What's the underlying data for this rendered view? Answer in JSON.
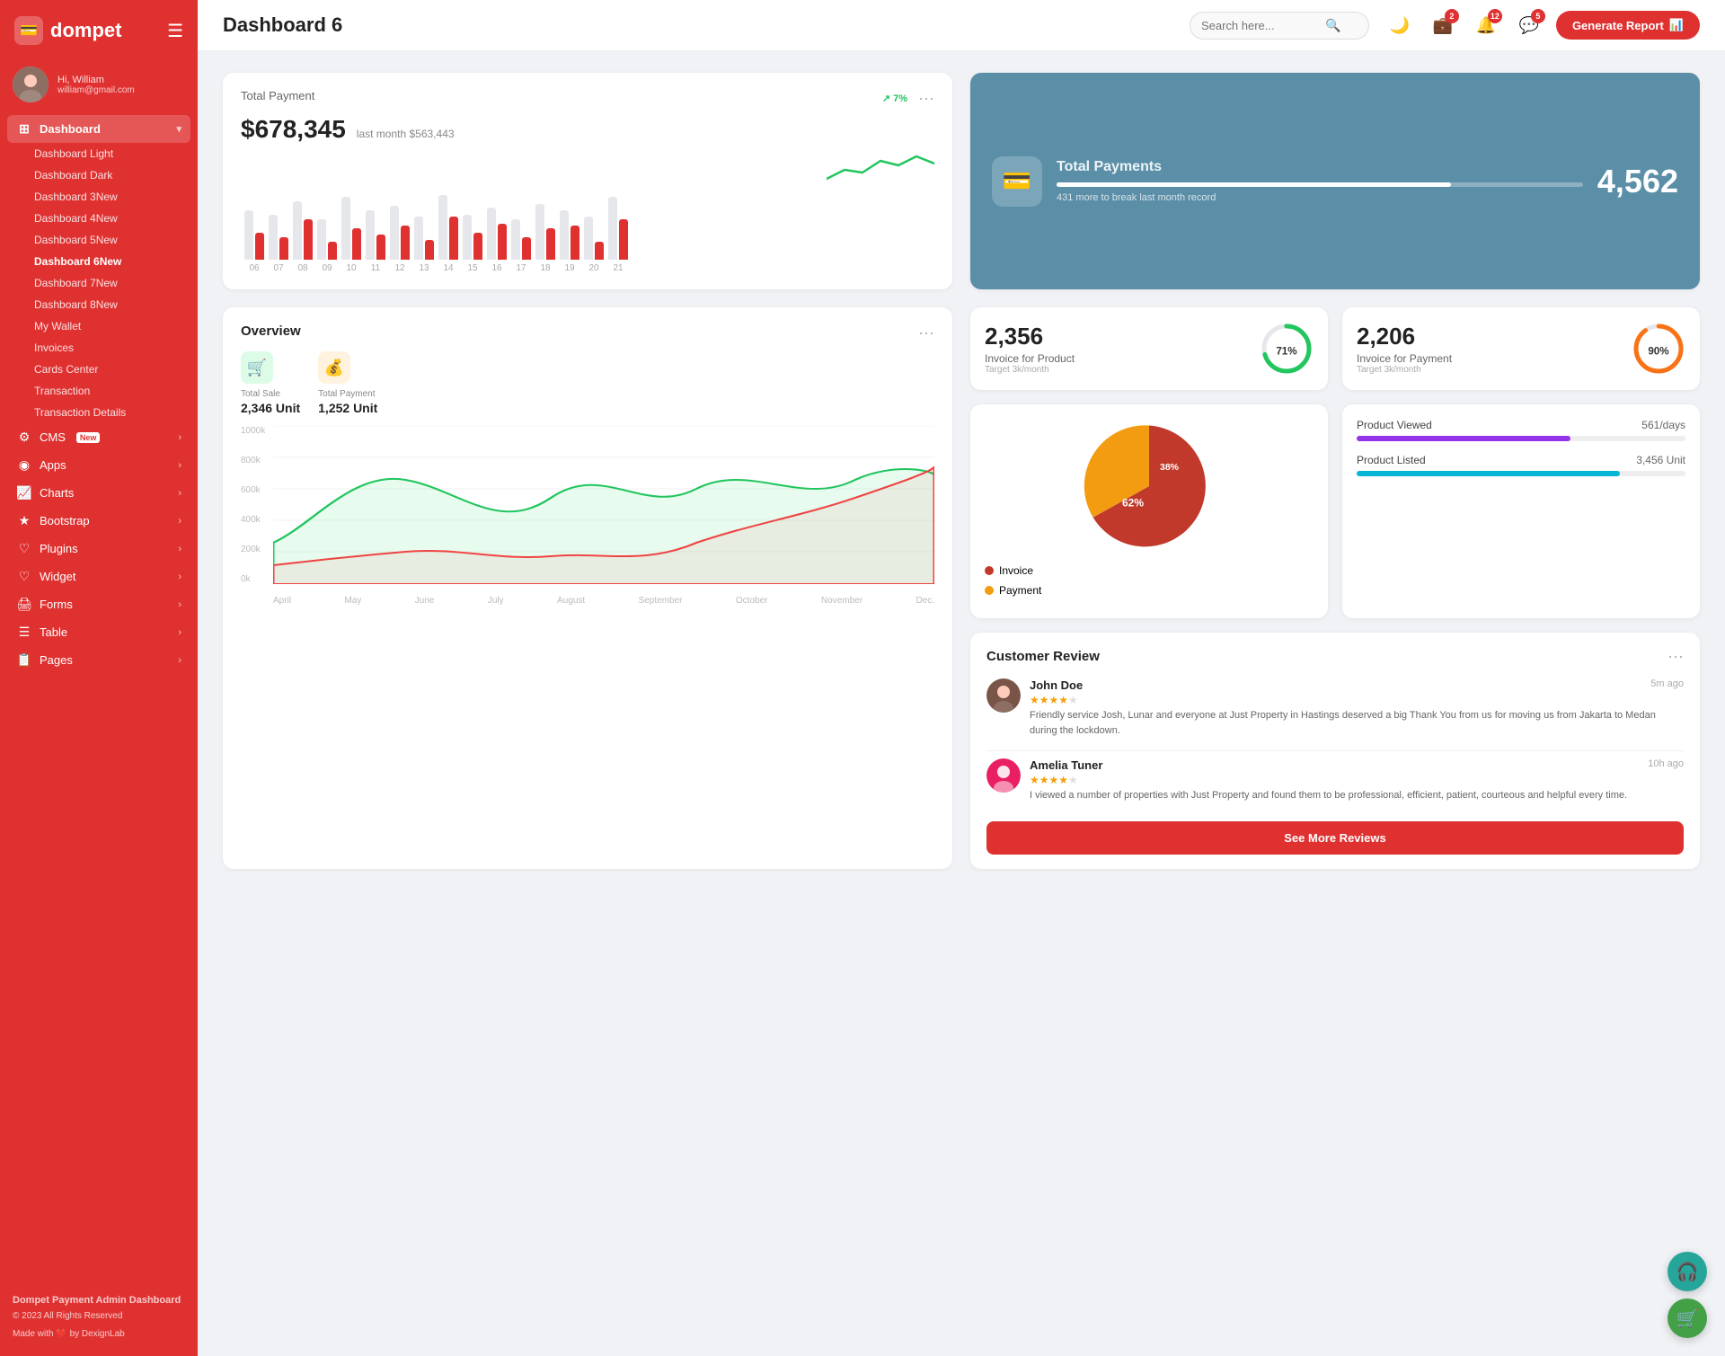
{
  "app": {
    "logo": "dompet",
    "logo_icon": "💳"
  },
  "user": {
    "greeting": "Hi, William",
    "name": "William",
    "email": "william@gmail.com"
  },
  "topbar": {
    "title": "Dashboard 6",
    "search_placeholder": "Search here...",
    "generate_btn": "Generate Report",
    "badges": {
      "wallet": "2",
      "bell": "12",
      "chat": "5"
    }
  },
  "sidebar": {
    "dashboard_label": "Dashboard",
    "items": [
      {
        "id": "dashboard-light",
        "label": "Dashboard Light",
        "badge": ""
      },
      {
        "id": "dashboard-dark",
        "label": "Dashboard Dark",
        "badge": ""
      },
      {
        "id": "dashboard-3",
        "label": "Dashboard 3",
        "badge": "New"
      },
      {
        "id": "dashboard-4",
        "label": "Dashboard 4",
        "badge": "New"
      },
      {
        "id": "dashboard-5",
        "label": "Dashboard 5",
        "badge": "New"
      },
      {
        "id": "dashboard-6",
        "label": "Dashboard 6",
        "badge": "New"
      },
      {
        "id": "dashboard-7",
        "label": "Dashboard 7",
        "badge": "New"
      },
      {
        "id": "dashboard-8",
        "label": "Dashboard 8",
        "badge": "New"
      },
      {
        "id": "my-wallet",
        "label": "My Wallet",
        "badge": ""
      },
      {
        "id": "invoices",
        "label": "Invoices",
        "badge": ""
      },
      {
        "id": "cards-center",
        "label": "Cards Center",
        "badge": ""
      },
      {
        "id": "transaction",
        "label": "Transaction",
        "badge": ""
      },
      {
        "id": "transaction-details",
        "label": "Transaction Details",
        "badge": ""
      }
    ],
    "nav_items": [
      {
        "id": "cms",
        "label": "CMS",
        "badge": "New",
        "has_arrow": true
      },
      {
        "id": "apps",
        "label": "Apps",
        "has_arrow": true
      },
      {
        "id": "charts",
        "label": "Charts",
        "has_arrow": true
      },
      {
        "id": "bootstrap",
        "label": "Bootstrap",
        "has_arrow": true
      },
      {
        "id": "plugins",
        "label": "Plugins",
        "has_arrow": true
      },
      {
        "id": "widget",
        "label": "Widget",
        "has_arrow": true
      },
      {
        "id": "forms",
        "label": "Forms",
        "has_arrow": true
      },
      {
        "id": "table",
        "label": "Table",
        "has_arrow": true
      },
      {
        "id": "pages",
        "label": "Pages",
        "has_arrow": true
      }
    ],
    "footer": {
      "title": "Dompet Payment Admin Dashboard",
      "copyright": "© 2023 All Rights Reserved",
      "made_with": "Made with ❤️ by DexignLab"
    }
  },
  "total_payment": {
    "label": "Total Payment",
    "amount": "$678,345",
    "last_month_label": "last month $563,443",
    "trend_pct": "7%",
    "trend_up": true,
    "bars": [
      {
        "month": "06",
        "g": 55,
        "r": 30
      },
      {
        "month": "07",
        "g": 50,
        "r": 25
      },
      {
        "month": "08",
        "g": 65,
        "r": 45
      },
      {
        "month": "09",
        "g": 45,
        "r": 20
      },
      {
        "month": "10",
        "g": 70,
        "r": 35
      },
      {
        "month": "11",
        "g": 55,
        "r": 28
      },
      {
        "month": "12",
        "g": 60,
        "r": 38
      },
      {
        "month": "13",
        "g": 48,
        "r": 22
      },
      {
        "month": "14",
        "g": 72,
        "r": 48
      },
      {
        "month": "15",
        "g": 50,
        "r": 30
      },
      {
        "month": "16",
        "g": 58,
        "r": 40
      },
      {
        "month": "17",
        "g": 45,
        "r": 25
      },
      {
        "month": "18",
        "g": 62,
        "r": 35
      },
      {
        "month": "19",
        "g": 55,
        "r": 38
      },
      {
        "month": "20",
        "g": 48,
        "r": 20
      },
      {
        "month": "21",
        "g": 70,
        "r": 45
      }
    ]
  },
  "total_payments_blue": {
    "title": "Total Payments",
    "subtitle": "431 more to break last month record",
    "count": "4,562",
    "progress": 75
  },
  "invoice_product": {
    "count": "2,356",
    "label": "Invoice for Product",
    "target": "Target 3k/month",
    "pct": 71,
    "color": "#22c55e"
  },
  "invoice_payment": {
    "count": "2,206",
    "label": "Invoice for Payment",
    "target": "Target 3k/month",
    "pct": 90,
    "color": "#f97316"
  },
  "overview": {
    "title": "Overview",
    "total_sale_label": "Total Sale",
    "total_sale_val": "2,346 Unit",
    "total_payment_label": "Total Payment",
    "total_payment_val": "1,252 Unit",
    "y_labels": [
      "1000k",
      "800k",
      "600k",
      "400k",
      "200k",
      "0k"
    ],
    "x_labels": [
      "April",
      "May",
      "June",
      "July",
      "August",
      "September",
      "October",
      "November",
      "Dec."
    ]
  },
  "pie_chart": {
    "invoice_pct": 62,
    "payment_pct": 38,
    "invoice_label": "Invoice",
    "payment_label": "Payment",
    "invoice_color": "#c0392b",
    "payment_color": "#f39c12"
  },
  "product_stats": {
    "viewed_label": "Product Viewed",
    "viewed_val": "561/days",
    "viewed_color": "#9333ea",
    "listed_label": "Product Listed",
    "listed_val": "3,456 Unit",
    "listed_color": "#06b6d4"
  },
  "reviews": {
    "title": "Customer Review",
    "see_more_btn": "See More Reviews",
    "items": [
      {
        "name": "John Doe",
        "time": "5m ago",
        "stars": 4,
        "text": "Friendly service Josh, Lunar and everyone at Just Property in Hastings deserved a big Thank You from us for moving us from Jakarta to Medan during the lockdown."
      },
      {
        "name": "Amelia Tuner",
        "time": "10h ago",
        "stars": 4,
        "text": "I viewed a number of properties with Just Property and found them to be professional, efficient, patient, courteous and helpful every time."
      }
    ]
  }
}
